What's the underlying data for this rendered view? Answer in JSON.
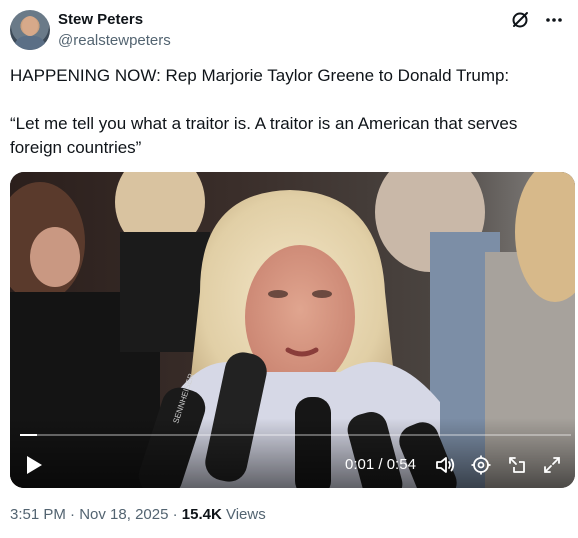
{
  "tweet": {
    "author_name": "Stew Peters",
    "author_handle": "@realstewpeters",
    "text_line1": "HAPPENING NOW: Rep Marjorie Taylor Greene to Donald Trump:",
    "text_line2": "“Let me tell you what a traitor is. A traitor is an American that serves foreign countries”"
  },
  "video": {
    "current_time": "0:01",
    "separator": " / ",
    "duration": "0:54",
    "progress_fraction": 0.03,
    "mic_label": "SENNHEISER"
  },
  "meta": {
    "time": "3:51 PM",
    "dot1": " · ",
    "date": "Nov 18, 2025",
    "dot2": " · ",
    "views_count": "15.4K",
    "views_label": " Views"
  },
  "icons": {
    "top": [
      "grok-icon",
      "more-icon"
    ],
    "video": [
      "play-icon",
      "volume-icon",
      "settings-icon",
      "pip-icon",
      "fullscreen-icon"
    ]
  }
}
